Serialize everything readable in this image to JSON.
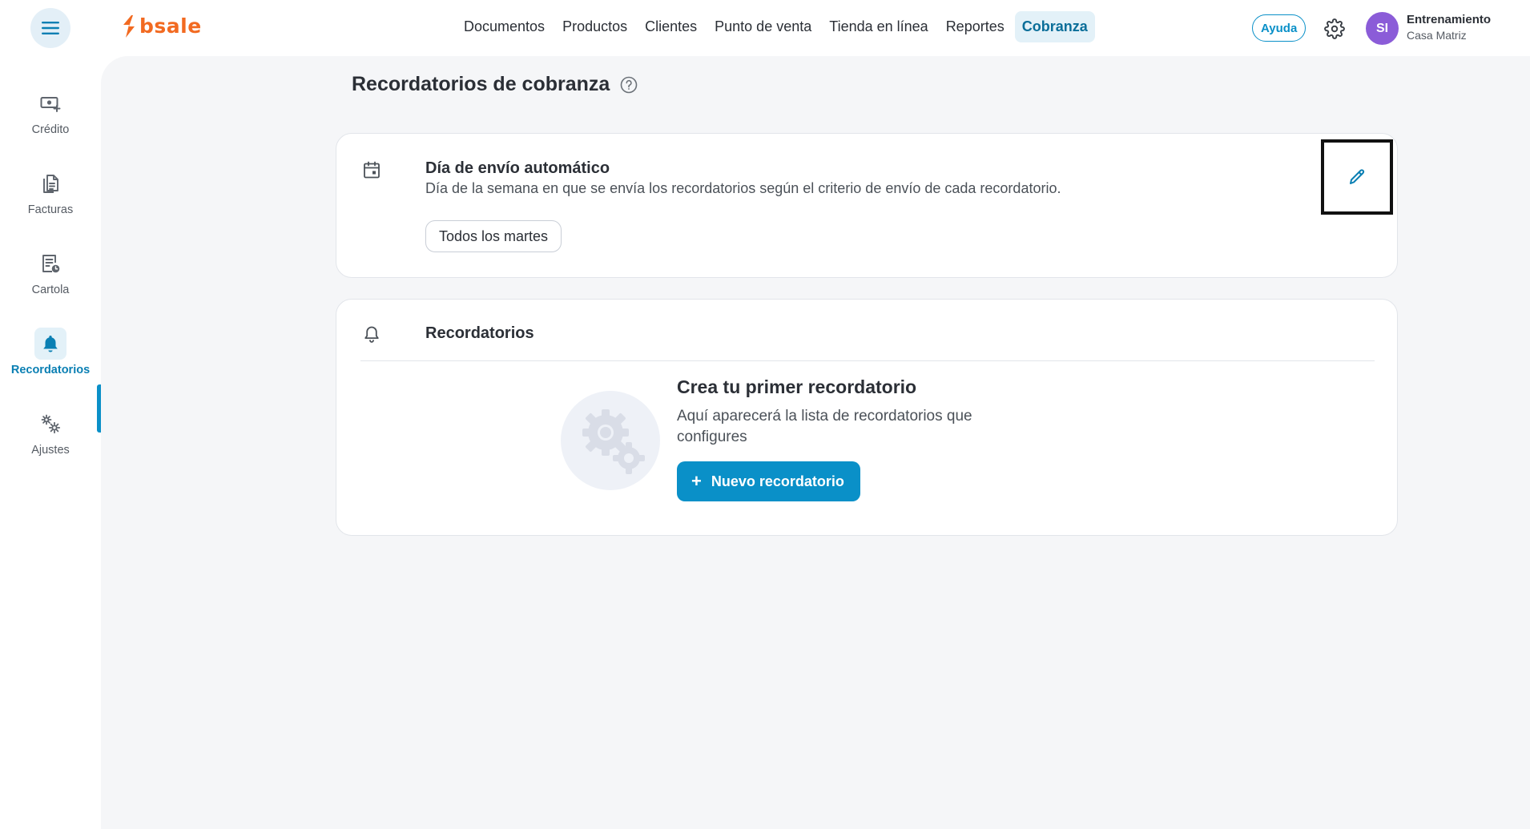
{
  "brand": {
    "name": "bsale",
    "color": "#f26a21"
  },
  "colors": {
    "primary": "#0a90c8",
    "active_bg": "#e3f1f8",
    "avatar": "#8b5cd8"
  },
  "header": {
    "nav": [
      {
        "label": "Documentos",
        "active": false
      },
      {
        "label": "Productos",
        "active": false
      },
      {
        "label": "Clientes",
        "active": false
      },
      {
        "label": "Punto de venta",
        "active": false
      },
      {
        "label": "Tienda en línea",
        "active": false
      },
      {
        "label": "Reportes",
        "active": false
      },
      {
        "label": "Cobranza",
        "active": true
      }
    ],
    "help_label": "Ayuda",
    "avatar_initials": "SI",
    "account_name": "Entrenamiento",
    "account_branch": "Casa Matriz",
    "icons": {
      "menu": "hamburger-icon",
      "settings": "gear-icon"
    }
  },
  "sidebar": {
    "items": [
      {
        "label": "Crédito",
        "icon": "money-add-icon",
        "active": false
      },
      {
        "label": "Facturas",
        "icon": "documents-icon",
        "active": false
      },
      {
        "label": "Cartola",
        "icon": "statement-clock-icon",
        "active": false
      },
      {
        "label": "Recordatorios",
        "icon": "bell-icon",
        "active": true
      },
      {
        "label": "Ajustes",
        "icon": "gears-icon",
        "active": false
      }
    ]
  },
  "page": {
    "title": "Recordatorios de cobranza",
    "auto_send": {
      "title": "Día de envío automático",
      "description": "Día de la semana en que se envía los recordatorios según el criterio de envío de cada recordatorio.",
      "chip": "Todos los martes",
      "icon": "calendar-icon",
      "edit_icon": "pencil-icon"
    },
    "reminders": {
      "title": "Recordatorios",
      "icon": "bell-outline-icon",
      "empty_title": "Crea tu primer recordatorio",
      "empty_description": "Aquí aparecerá la lista de recordatorios que configures",
      "new_button": "Nuevo recordatorio"
    }
  }
}
